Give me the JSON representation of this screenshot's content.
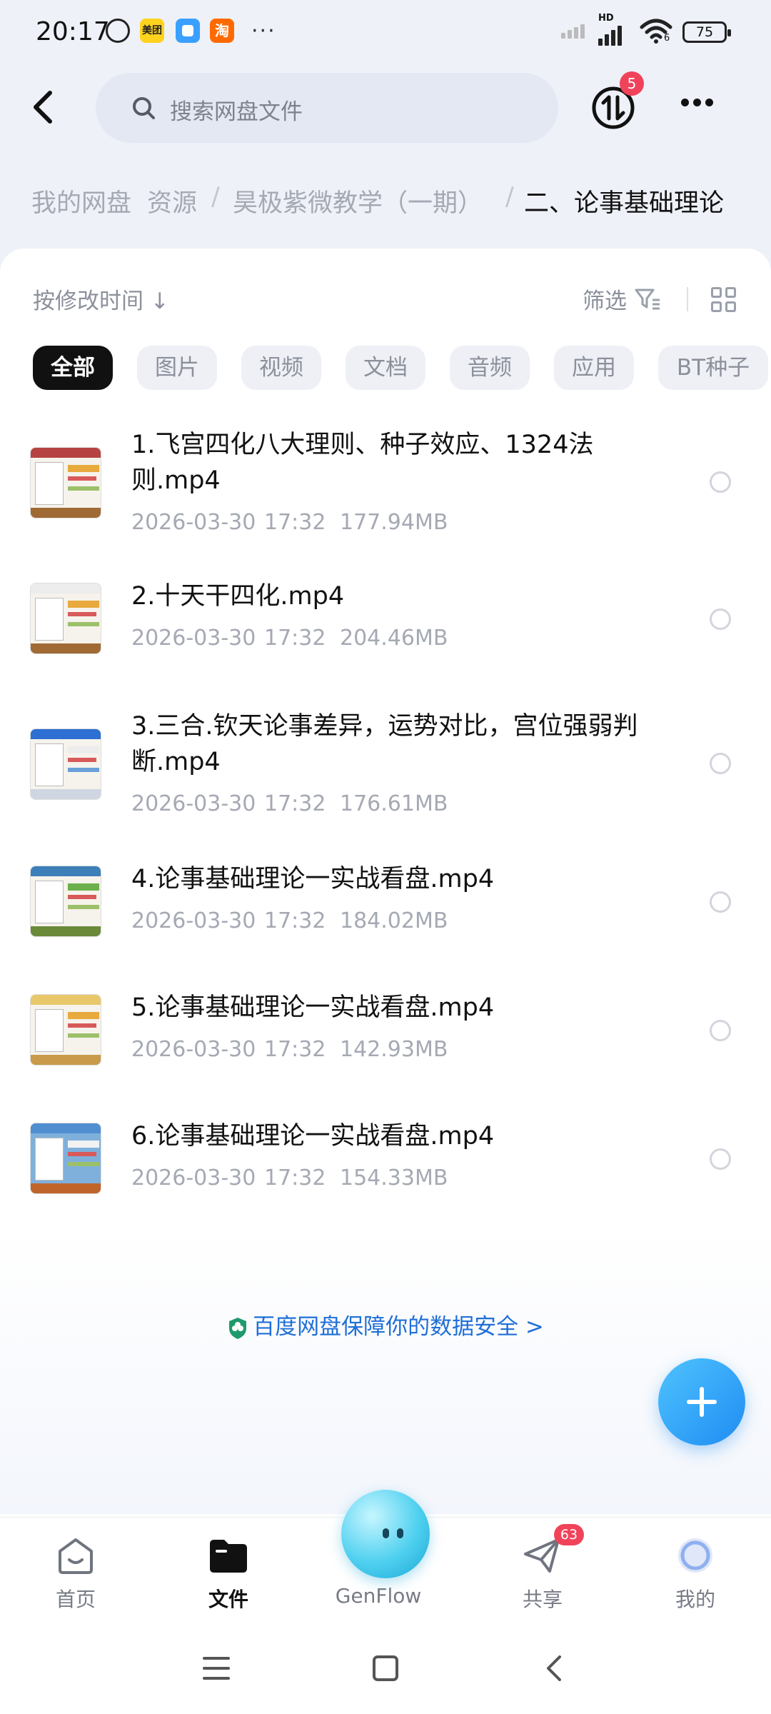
{
  "status_bar": {
    "time": "20:17",
    "app_meituan": "美团",
    "app_taobao": "淘",
    "more": "···",
    "network": "HD",
    "wifi_label": "6",
    "battery": "75"
  },
  "header": {
    "search_placeholder": "搜索网盘文件",
    "transfer_badge": "5"
  },
  "breadcrumb": {
    "items": [
      "我的网盘",
      "资源",
      "昊极紫微教学（一期）",
      "二、论事基础理论"
    ]
  },
  "toolbar": {
    "sort_label": "按修改时间 ↓",
    "filter_label": "筛选"
  },
  "chips": [
    "全部",
    "图片",
    "视频",
    "文档",
    "音频",
    "应用",
    "BT种子"
  ],
  "files": [
    {
      "name_line1": "1.飞宫四化八大理则、种子效应、1324法",
      "name_line2": "则.mp4",
      "date": "2026-03-30",
      "time": "17:32",
      "size": "177.94MB"
    },
    {
      "name_line1": "2.十天干四化.mp4",
      "name_line2": "",
      "date": "2026-03-30",
      "time": "17:32",
      "size": "204.46MB"
    },
    {
      "name_line1": "3.三合.钦天论事差异，运势对比，宫位强弱判",
      "name_line2": "断.mp4",
      "date": "2026-03-30",
      "time": "17:32",
      "size": "176.61MB"
    },
    {
      "name_line1": "4.论事基础理论一实战看盘.mp4",
      "name_line2": "",
      "date": "2026-03-30",
      "time": "17:32",
      "size": "184.02MB"
    },
    {
      "name_line1": "5.论事基础理论一实战看盘.mp4",
      "name_line2": "",
      "date": "2026-03-30",
      "time": "17:32",
      "size": "142.93MB"
    },
    {
      "name_line1": "6.论事基础理论一实战看盘.mp4",
      "name_line2": "",
      "date": "2026-03-30",
      "time": "17:32",
      "size": "154.33MB"
    }
  ],
  "security_text": "百度网盘保障你的数据安全 >",
  "nav": {
    "home": "首页",
    "files": "文件",
    "genflow": "GenFlow",
    "share": "共享",
    "share_badge": "63",
    "me": "我的"
  },
  "colors": {
    "accent": "#1f8cf2",
    "badge": "#f0435a",
    "chip_active": "#111111",
    "security_link": "#1f6fd8"
  }
}
